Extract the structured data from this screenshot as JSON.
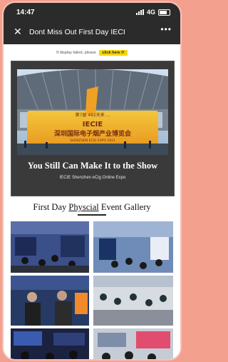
{
  "status_bar": {
    "time": "14:47",
    "network": "4G"
  },
  "nav": {
    "close_glyph": "✕",
    "title": "Dont Miss Out First Day IECI",
    "more_glyph": "•••"
  },
  "notice": {
    "text": "If display failed, please",
    "button_label": "click here"
  },
  "banner": {
    "headline": "You Still Can Make It to the Show",
    "subline": "IECIE Shenzhen eCig Online Expo",
    "sign_line1": "IECIE",
    "sign_line2": "深圳国际电子烟产业博览会",
    "sign_line3": "SHENZHEN ECIG EXPO 2021",
    "sign_top": "第7届 492天来 ...",
    "accent_color": "#f5a41d"
  },
  "gallery": {
    "title_pre": "First Day ",
    "title_u": "Physcial",
    "title_post": " Event Gallery"
  },
  "colors": {
    "app_bar": "#2b2b2b",
    "page_bg": "#f4a08f",
    "notice_button": "#f5d70d"
  }
}
